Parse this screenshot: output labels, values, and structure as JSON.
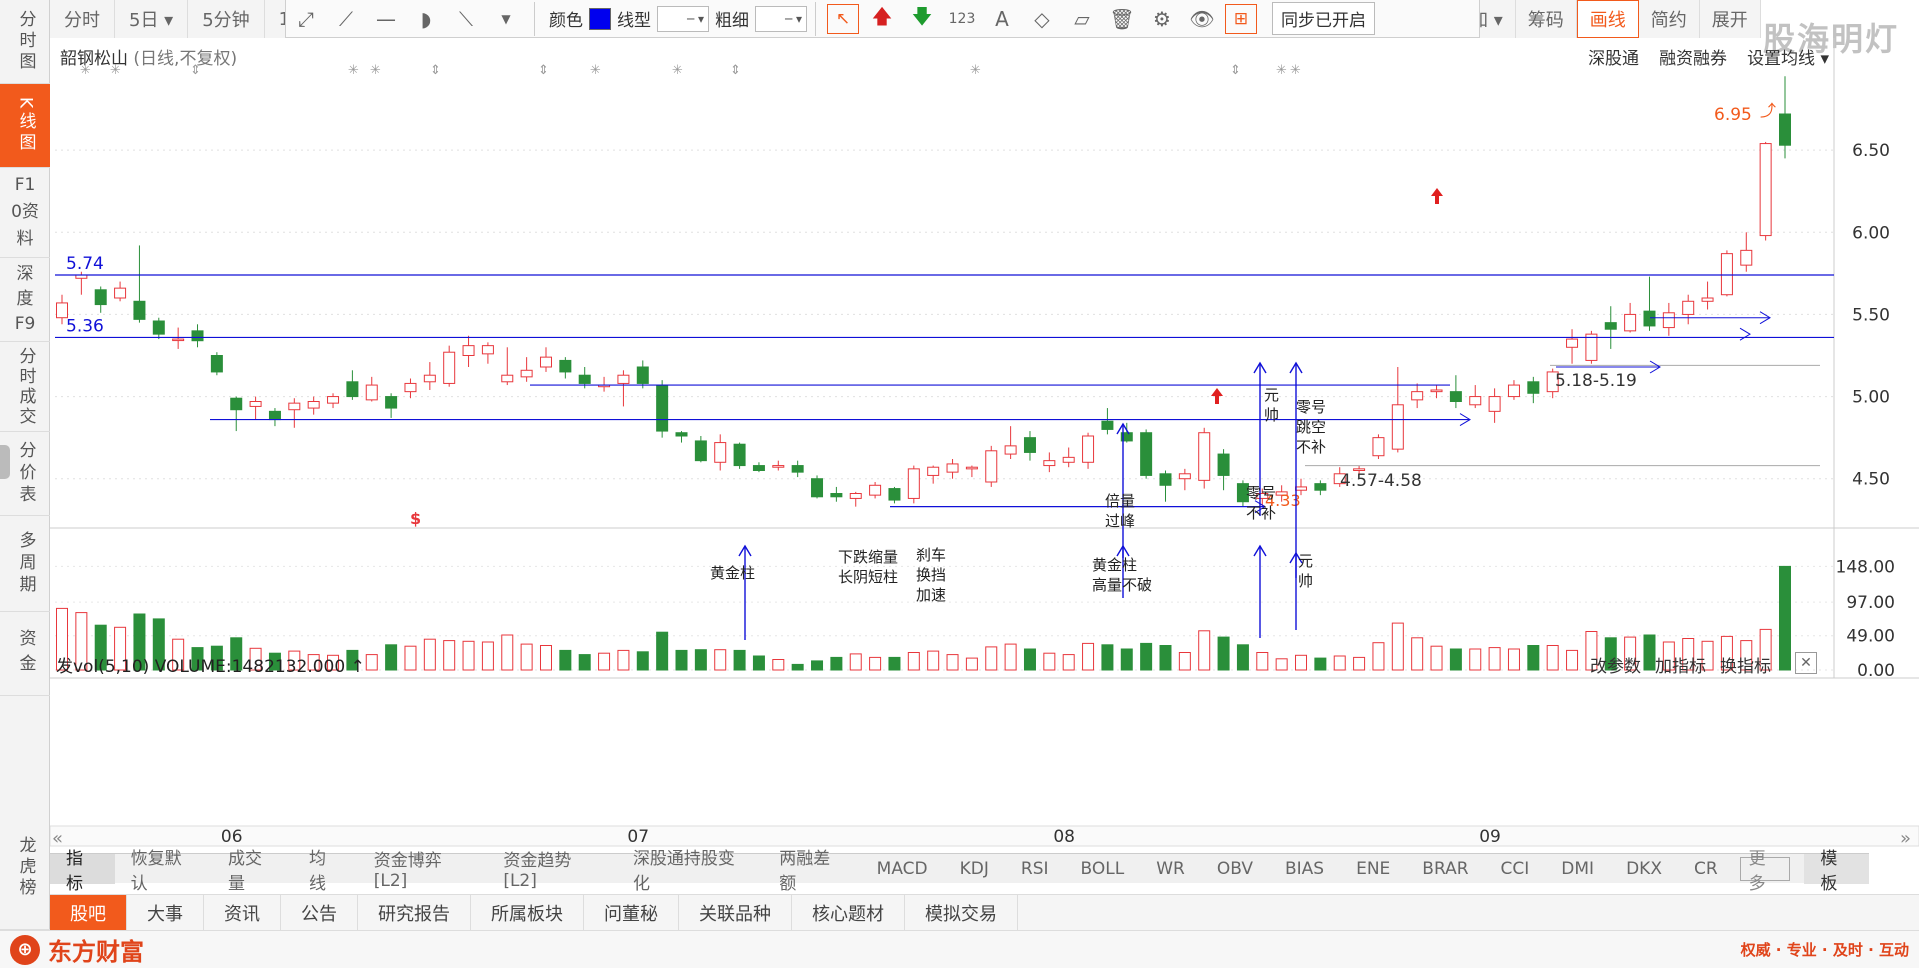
{
  "left_nav": [
    {
      "label": "分时图",
      "active": false
    },
    {
      "label": "K线图",
      "active": true
    },
    {
      "label": "F10资料",
      "active": false
    },
    {
      "label": "深度F9",
      "active": false
    },
    {
      "label": "分时成交",
      "active": false
    },
    {
      "label": "分价表",
      "active": false
    },
    {
      "label": "多周期",
      "active": false
    },
    {
      "label": "资金",
      "active": false
    },
    {
      "label": "龙虎榜",
      "active": false
    }
  ],
  "period_tabs": [
    "分时",
    "5日 ▾",
    "5分钟",
    "1"
  ],
  "draw_toolbar": {
    "color_label": "颜色",
    "line_type_label": "线型",
    "thickness_label": "粗细",
    "sync_label": "同步已开启",
    "accent_color": "#0000ee"
  },
  "right_tabs": [
    "叠加 ▾",
    "筹码",
    "画线",
    "简约",
    "展开"
  ],
  "watermark": "股海明灯",
  "chart": {
    "stock_name": "韶钢松山",
    "subtitle": "(日线,不复权)",
    "top_links": [
      "深股通",
      "融资融券",
      "设置均线 ▾"
    ],
    "price_labels": [
      "6.50",
      "6.00",
      "5.50",
      "5.00",
      "4.50"
    ],
    "volume_labels": [
      "148.00",
      "97.00",
      "49.00",
      "0.00"
    ],
    "month_labels": [
      "06",
      "07",
      "08",
      "09"
    ],
    "level_574": "5.74",
    "level_536": "5.36",
    "high_label": "6.95",
    "low_label": "4.33",
    "range_1": "4.57-4.58",
    "range_2": "5.18-5.19",
    "dollar_mark": "$"
  },
  "annotations": {
    "golden_bar": "黄金柱",
    "falling_shrink_1": "下跌缩量",
    "falling_shrink_2": "长阴短柱",
    "brake_1": "刹车",
    "brake_2": "换挡",
    "brake_3": "加速",
    "golden_high_1": "黄金柱",
    "golden_high_2": "高量不破",
    "double_peak_1": "倍量",
    "double_peak_2": "过峰",
    "zero_1": "零号",
    "zero_2": "不补",
    "marshal_1": "元",
    "marshal_2": "帅",
    "zero_gap_1": "零号",
    "zero_gap_2": "跳空",
    "zero_gap_3": "不补",
    "marshal_vol_1": "元",
    "marshal_vol_2": "帅"
  },
  "volume": {
    "header": "发vol(5,10)  VOLUME:1482132.000 ↑",
    "links": [
      "改参数",
      "加指标",
      "换指标"
    ]
  },
  "indicator_tabs": [
    "指标",
    "恢复默认",
    "成交量",
    "均线",
    "资金博弈[L2]",
    "资金趋势[L2]",
    "深股通持股变化",
    "两融差额",
    "MACD",
    "KDJ",
    "RSI",
    "BOLL",
    "WR",
    "OBV",
    "BIAS",
    "ENE",
    "BRAR",
    "CCI",
    "DMI",
    "DKX",
    "CR"
  ],
  "indicator_more": "更多",
  "indicator_template": "模板",
  "bottom_nav": [
    "股吧",
    "大事",
    "资讯",
    "公告",
    "研究报告",
    "所属板块",
    "问董秘",
    "关联品种",
    "核心题材",
    "模拟交易"
  ],
  "footer": {
    "logo_text": "东方财富",
    "slogan": "权威 · 专业 · 及时 · 互动"
  },
  "colors": {
    "up": "#e8373c",
    "down": "#2a8f3a",
    "accent": "#f25a1c",
    "line_blue": "#1010d8"
  },
  "candles": [
    {
      "o": 5.48,
      "c": 5.57,
      "h": 5.62,
      "l": 5.44,
      "v": 88,
      "d": "2025-05-26"
    },
    {
      "o": 5.72,
      "c": 5.74,
      "h": 5.76,
      "l": 5.62,
      "v": 82,
      "d": "2025-05-27"
    },
    {
      "o": 5.65,
      "c": 5.56,
      "h": 5.67,
      "l": 5.51,
      "v": 64,
      "d": "2025-05-28"
    },
    {
      "o": 5.6,
      "c": 5.66,
      "h": 5.7,
      "l": 5.58,
      "v": 61,
      "d": "2025-05-29"
    },
    {
      "o": 5.58,
      "c": 5.47,
      "h": 5.92,
      "l": 5.45,
      "v": 80,
      "d": "2025-05-30"
    },
    {
      "o": 5.46,
      "c": 5.38,
      "h": 5.48,
      "l": 5.35,
      "v": 73,
      "d": "2025-06-02"
    },
    {
      "o": 5.35,
      "c": 5.35,
      "h": 5.42,
      "l": 5.29,
      "v": 44,
      "d": "2025-06-03"
    },
    {
      "o": 5.4,
      "c": 5.34,
      "h": 5.44,
      "l": 5.3,
      "v": 32,
      "d": "2025-06-04"
    },
    {
      "o": 5.25,
      "c": 5.15,
      "h": 5.27,
      "l": 5.13,
      "v": 34,
      "d": "2025-06-05"
    },
    {
      "o": 4.99,
      "c": 4.92,
      "h": 5.0,
      "l": 4.79,
      "v": 46,
      "d": "2025-06-06"
    },
    {
      "o": 4.94,
      "c": 4.97,
      "h": 5.0,
      "l": 4.86,
      "v": 31,
      "d": "2025-06-09"
    },
    {
      "o": 4.91,
      "c": 4.86,
      "h": 4.93,
      "l": 4.82,
      "v": 24,
      "d": "2025-06-10"
    },
    {
      "o": 4.92,
      "c": 4.96,
      "h": 4.99,
      "l": 4.81,
      "v": 27,
      "d": "2025-06-11"
    },
    {
      "o": 4.93,
      "c": 4.97,
      "h": 5.0,
      "l": 4.89,
      "v": 22,
      "d": "2025-06-12"
    },
    {
      "o": 4.96,
      "c": 5.0,
      "h": 5.02,
      "l": 4.93,
      "v": 21,
      "d": "2025-06-13"
    },
    {
      "o": 5.09,
      "c": 5.0,
      "h": 5.16,
      "l": 4.98,
      "v": 28,
      "d": "2025-06-16"
    },
    {
      "o": 4.98,
      "c": 5.07,
      "h": 5.12,
      "l": 4.97,
      "v": 22,
      "d": "2025-06-17"
    },
    {
      "o": 5.0,
      "c": 4.93,
      "h": 5.02,
      "l": 4.87,
      "v": 36,
      "d": "2025-06-18"
    },
    {
      "o": 5.03,
      "c": 5.08,
      "h": 5.11,
      "l": 4.99,
      "v": 34,
      "d": "2025-06-19"
    },
    {
      "o": 5.09,
      "c": 5.13,
      "h": 5.21,
      "l": 5.04,
      "v": 44,
      "d": "2025-06-20"
    },
    {
      "o": 5.08,
      "c": 5.27,
      "h": 5.31,
      "l": 5.06,
      "v": 42,
      "d": "2025-06-23"
    },
    {
      "o": 5.25,
      "c": 5.31,
      "h": 5.37,
      "l": 5.18,
      "v": 41,
      "d": "2025-06-24"
    },
    {
      "o": 5.26,
      "c": 5.31,
      "h": 5.33,
      "l": 5.2,
      "v": 40,
      "d": "2025-06-25"
    },
    {
      "o": 5.09,
      "c": 5.13,
      "h": 5.3,
      "l": 5.07,
      "v": 50,
      "d": "2025-06-26"
    },
    {
      "o": 5.12,
      "c": 5.16,
      "h": 5.24,
      "l": 5.09,
      "v": 37,
      "d": "2025-06-27"
    },
    {
      "o": 5.18,
      "c": 5.24,
      "h": 5.3,
      "l": 5.15,
      "v": 35,
      "d": "2025-06-30"
    },
    {
      "o": 5.22,
      "c": 5.15,
      "h": 5.24,
      "l": 5.11,
      "v": 28,
      "d": "2025-07-01"
    },
    {
      "o": 5.13,
      "c": 5.08,
      "h": 5.18,
      "l": 5.05,
      "v": 22,
      "d": "2025-07-02"
    },
    {
      "o": 5.06,
      "c": 5.07,
      "h": 5.12,
      "l": 5.03,
      "v": 24,
      "d": "2025-07-03"
    },
    {
      "o": 5.08,
      "c": 5.13,
      "h": 5.16,
      "l": 4.94,
      "v": 28,
      "d": "2025-07-04"
    },
    {
      "o": 5.18,
      "c": 5.08,
      "h": 5.22,
      "l": 5.05,
      "v": 26,
      "d": "2025-07-07"
    },
    {
      "o": 5.07,
      "c": 4.79,
      "h": 5.1,
      "l": 4.75,
      "v": 54,
      "d": "2025-07-08"
    },
    {
      "o": 4.78,
      "c": 4.76,
      "h": 4.79,
      "l": 4.72,
      "v": 28,
      "d": "2025-07-09"
    },
    {
      "o": 4.73,
      "c": 4.61,
      "h": 4.76,
      "l": 4.6,
      "v": 29,
      "d": "2025-07-10"
    },
    {
      "o": 4.6,
      "c": 4.72,
      "h": 4.77,
      "l": 4.55,
      "v": 29,
      "d": "2025-07-11"
    },
    {
      "o": 4.71,
      "c": 4.58,
      "h": 4.72,
      "l": 4.56,
      "v": 28,
      "d": "2025-07-14"
    },
    {
      "o": 4.58,
      "c": 4.55,
      "h": 4.6,
      "l": 4.54,
      "v": 20,
      "d": "2025-07-15"
    },
    {
      "o": 4.57,
      "c": 4.58,
      "h": 4.61,
      "l": 4.55,
      "v": 15,
      "d": "2025-07-16"
    },
    {
      "o": 4.58,
      "c": 4.54,
      "h": 4.61,
      "l": 4.51,
      "v": 8,
      "d": "2025-07-17"
    },
    {
      "o": 4.5,
      "c": 4.39,
      "h": 4.52,
      "l": 4.38,
      "v": 13,
      "d": "2025-07-18"
    },
    {
      "o": 4.41,
      "c": 4.39,
      "h": 4.45,
      "l": 4.36,
      "v": 18,
      "d": "2025-07-21"
    },
    {
      "o": 4.38,
      "c": 4.41,
      "h": 4.42,
      "l": 4.33,
      "v": 23,
      "d": "2025-07-22"
    },
    {
      "o": 4.4,
      "c": 4.46,
      "h": 4.48,
      "l": 4.38,
      "v": 18,
      "d": "2025-07-23"
    },
    {
      "o": 4.44,
      "c": 4.37,
      "h": 4.45,
      "l": 4.35,
      "v": 18,
      "d": "2025-07-24"
    },
    {
      "o": 4.38,
      "c": 4.56,
      "h": 4.58,
      "l": 4.35,
      "v": 25,
      "d": "2025-07-25"
    },
    {
      "o": 4.52,
      "c": 4.57,
      "h": 4.58,
      "l": 4.47,
      "v": 27,
      "d": "2025-07-28"
    },
    {
      "o": 4.54,
      "c": 4.59,
      "h": 4.62,
      "l": 4.5,
      "v": 22,
      "d": "2025-07-29"
    },
    {
      "o": 4.56,
      "c": 4.57,
      "h": 4.58,
      "l": 4.51,
      "v": 17,
      "d": "2025-07-30"
    },
    {
      "o": 4.48,
      "c": 4.67,
      "h": 4.7,
      "l": 4.45,
      "v": 33,
      "d": "2025-07-31"
    },
    {
      "o": 4.65,
      "c": 4.7,
      "h": 4.82,
      "l": 4.62,
      "v": 37,
      "d": "2025-08-01"
    },
    {
      "o": 4.75,
      "c": 4.66,
      "h": 4.79,
      "l": 4.61,
      "v": 30,
      "d": "2025-08-04"
    },
    {
      "o": 4.58,
      "c": 4.61,
      "h": 4.66,
      "l": 4.54,
      "v": 24,
      "d": "2025-08-05"
    },
    {
      "o": 4.6,
      "c": 4.63,
      "h": 4.69,
      "l": 4.57,
      "v": 22,
      "d": "2025-08-06"
    },
    {
      "o": 4.6,
      "c": 4.76,
      "h": 4.78,
      "l": 4.56,
      "v": 38,
      "d": "2025-08-07"
    },
    {
      "o": 4.85,
      "c": 4.8,
      "h": 4.93,
      "l": 4.77,
      "v": 36,
      "d": "2025-08-08"
    },
    {
      "o": 4.78,
      "c": 4.73,
      "h": 4.84,
      "l": 4.72,
      "v": 30,
      "d": "2025-08-11"
    },
    {
      "o": 4.78,
      "c": 4.52,
      "h": 4.8,
      "l": 4.5,
      "v": 38,
      "d": "2025-08-12"
    },
    {
      "o": 4.53,
      "c": 4.46,
      "h": 4.55,
      "l": 4.36,
      "v": 35,
      "d": "2025-08-13"
    },
    {
      "o": 4.5,
      "c": 4.53,
      "h": 4.56,
      "l": 4.43,
      "v": 25,
      "d": "2025-08-14"
    },
    {
      "o": 4.49,
      "c": 4.78,
      "h": 4.81,
      "l": 4.44,
      "v": 56,
      "d": "2025-08-15"
    },
    {
      "o": 4.65,
      "c": 4.52,
      "h": 4.68,
      "l": 4.43,
      "v": 47,
      "d": "2025-08-18"
    },
    {
      "o": 4.47,
      "c": 4.36,
      "h": 4.49,
      "l": 4.33,
      "v": 36,
      "d": "2025-08-19"
    },
    {
      "o": 4.38,
      "c": 4.41,
      "h": 4.44,
      "l": 4.33,
      "v": 25,
      "d": "2025-08-20"
    },
    {
      "o": 4.4,
      "c": 4.42,
      "h": 4.46,
      "l": 4.36,
      "v": 16,
      "d": "2025-08-21"
    },
    {
      "o": 4.43,
      "c": 4.45,
      "h": 4.5,
      "l": 4.4,
      "v": 21,
      "d": "2025-08-22"
    },
    {
      "o": 4.47,
      "c": 4.43,
      "h": 4.49,
      "l": 4.4,
      "v": 17,
      "d": "2025-08-25"
    },
    {
      "o": 4.47,
      "c": 4.53,
      "h": 4.57,
      "l": 4.45,
      "v": 20,
      "d": "2025-08-26"
    },
    {
      "o": 4.55,
      "c": 4.56,
      "h": 4.58,
      "l": 4.53,
      "v": 18,
      "d": "2025-08-27"
    },
    {
      "o": 4.64,
      "c": 4.75,
      "h": 4.77,
      "l": 4.62,
      "v": 39,
      "d": "2025-08-28"
    },
    {
      "o": 4.68,
      "c": 4.95,
      "h": 5.18,
      "l": 4.66,
      "v": 67,
      "d": "2025-08-29"
    },
    {
      "o": 4.98,
      "c": 5.03,
      "h": 5.08,
      "l": 4.93,
      "v": 46,
      "d": "2025-09-01"
    },
    {
      "o": 5.03,
      "c": 5.04,
      "h": 5.07,
      "l": 4.99,
      "v": 34,
      "d": "2025-09-02"
    },
    {
      "o": 5.03,
      "c": 4.97,
      "h": 5.13,
      "l": 4.93,
      "v": 30,
      "d": "2025-09-03"
    },
    {
      "o": 4.95,
      "c": 5.0,
      "h": 5.07,
      "l": 4.93,
      "v": 30,
      "d": "2025-09-04"
    },
    {
      "o": 4.91,
      "c": 5.0,
      "h": 5.05,
      "l": 4.84,
      "v": 32,
      "d": "2025-09-05"
    },
    {
      "o": 5.0,
      "c": 5.07,
      "h": 5.1,
      "l": 4.98,
      "v": 30,
      "d": "2025-09-08"
    },
    {
      "o": 5.09,
      "c": 5.02,
      "h": 5.12,
      "l": 4.96,
      "v": 35,
      "d": "2025-09-09"
    },
    {
      "o": 5.03,
      "c": 5.15,
      "h": 5.17,
      "l": 4.99,
      "v": 35,
      "d": "2025-09-10"
    },
    {
      "o": 5.3,
      "c": 5.35,
      "h": 5.41,
      "l": 5.2,
      "v": 28,
      "d": "2025-09-11"
    },
    {
      "o": 5.22,
      "c": 5.38,
      "h": 5.4,
      "l": 5.2,
      "v": 55,
      "d": "2025-09-12"
    },
    {
      "o": 5.45,
      "c": 5.41,
      "h": 5.55,
      "l": 5.29,
      "v": 46,
      "d": "2025-09-15"
    },
    {
      "o": 5.4,
      "c": 5.5,
      "h": 5.57,
      "l": 5.39,
      "v": 47,
      "d": "2025-09-16"
    },
    {
      "o": 5.52,
      "c": 5.43,
      "h": 5.73,
      "l": 5.4,
      "v": 50,
      "d": "2025-09-17"
    },
    {
      "o": 5.42,
      "c": 5.51,
      "h": 5.57,
      "l": 5.37,
      "v": 40,
      "d": "2025-09-18"
    },
    {
      "o": 5.5,
      "c": 5.58,
      "h": 5.62,
      "l": 5.44,
      "v": 45,
      "d": "2025-09-19"
    },
    {
      "o": 5.58,
      "c": 5.6,
      "h": 5.7,
      "l": 5.53,
      "v": 41,
      "d": "2025-09-22"
    },
    {
      "o": 5.62,
      "c": 5.87,
      "h": 5.89,
      "l": 5.61,
      "v": 48,
      "d": "2025-09-23"
    },
    {
      "o": 5.8,
      "c": 5.89,
      "h": 6.0,
      "l": 5.76,
      "v": 42,
      "d": "2025-09-24"
    },
    {
      "o": 5.98,
      "c": 6.54,
      "h": 6.55,
      "l": 5.95,
      "v": 58,
      "d": "2025-09-25"
    },
    {
      "o": 6.72,
      "c": 6.53,
      "h": 6.95,
      "l": 6.45,
      "v": 148,
      "d": "2025-09-26"
    }
  ]
}
